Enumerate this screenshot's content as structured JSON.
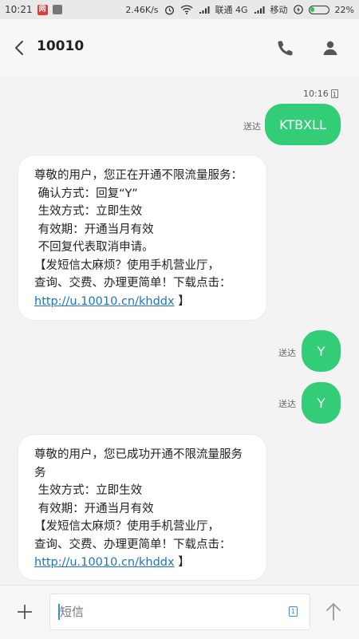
{
  "status_bar": {
    "time": "10:21",
    "net_speed": "2.46K/s",
    "carrier1": "联通 4G",
    "carrier2": "移动",
    "battery": "22%"
  },
  "header": {
    "title": "10010"
  },
  "messages": {
    "timestamp": "10:16",
    "sim_slot": "1",
    "sent_label": "送达",
    "out1": "KTBXLL",
    "in1": {
      "lines": [
        "尊敬的用户，您正在开通不限流量服务：",
        " 确认方式：回复“Y”",
        " 生效方式：立即生效",
        " 有效期：开通当月有效",
        " 不回复代表取消申请。",
        "【发短信太麻烦？使用手机营业厅，",
        "查询、交费、办理更简单！下载点击："
      ],
      "link": "http://u.10010.cn/khddx",
      "end": " 】"
    },
    "out2": "Y",
    "out3": "Y",
    "in2": {
      "lines": [
        "尊敬的用户，您已成功开通不限流量服务",
        "务",
        " 生效方式：立即生效",
        " 有效期：开通当月有效",
        "【发短信太麻烦？使用手机营业厅，",
        "查询、交费、办理更简单！下载点击："
      ],
      "link": "http://u.10010.cn/khddx",
      "end": " 】"
    }
  },
  "composer": {
    "placeholder": "短信",
    "sim_slot": "1"
  },
  "colors": {
    "sent_bubble": "#33cc77",
    "link": "#1a73c9",
    "accent": "#3a87ff"
  }
}
